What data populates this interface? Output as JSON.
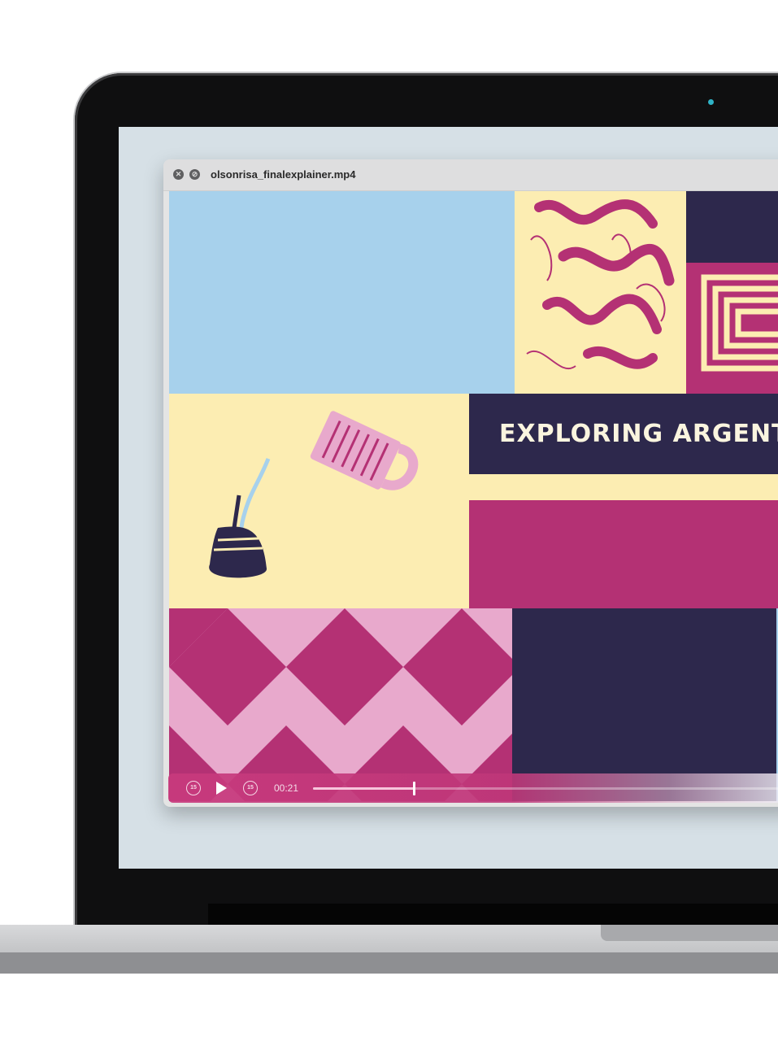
{
  "window": {
    "title": "olsonrisa_finalexplainer.mp4",
    "close_glyph": "✕",
    "minimize_glyph": "⊘"
  },
  "video": {
    "title_text": "EXPLORING ARGENTI",
    "colors": {
      "sky": "#a7d1ec",
      "cream": "#fcedb2",
      "magenta": "#b43174",
      "navy": "#2d284c",
      "pink": "#e8a9cc"
    }
  },
  "player": {
    "current_time": "00:21",
    "skip_back_label": "15",
    "skip_forward_label": "15",
    "progress": 0.21,
    "icons": [
      "skip-back-15-icon",
      "play-icon",
      "skip-forward-15-icon"
    ]
  }
}
